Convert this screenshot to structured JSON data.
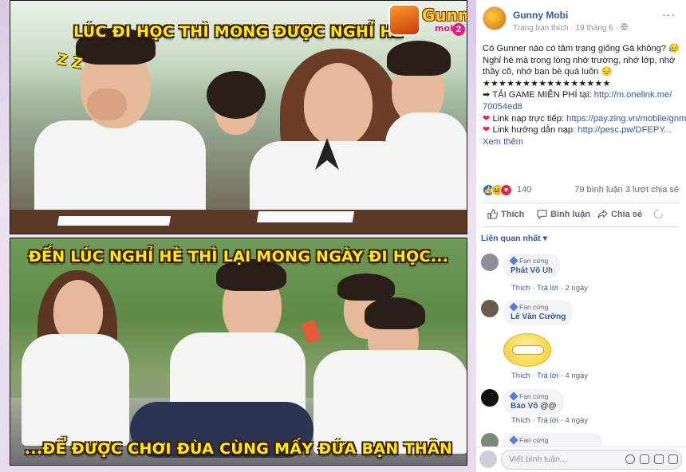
{
  "media": {
    "caption_top": "LÚC ĐI HỌC THÌ MONG ĐƯỢC NGHỈ HÈ",
    "caption_mid": "ĐẾN LÚC NGHỈ HÈ THÌ LẠI MONG NGÀY ĐI HỌC...",
    "caption_bottom": "...ĐỂ ĐƯỢC CHƠI ĐÙA CÙNG MẤY ĐỨA BẠN THÂN",
    "sleep_mark": "Z Z",
    "logo": {
      "word": "Gunny",
      "sub": "mobi",
      "num": "2"
    }
  },
  "post": {
    "page_name": "Gunny Mobi",
    "meta": "Trang bạn thích · 19 tháng 6 · ",
    "more_label": "···",
    "lines": [
      "Có Gunner nào có tâm trạng giống Gà không? 😥",
      "Nghỉ hè mà trong lòng nhớ trường, nhớ lớp, nhớ",
      "thầy cô, nhớ bạn bè quá luôn 😔",
      "★★★★★★★★★★★★★★★★"
    ],
    "download_prefix": "➡ TẢI GAME MIỄN PHÍ tại: ",
    "download_link_1": "http://m.onelink.me/",
    "download_link_2": "70054ed8",
    "topup_prefix": "Link nạp trực tiếp: ",
    "topup_link": "https://pay.zing.vn/mobile/gnm",
    "guide_prefix": "Link hướng dẫn nạp: ",
    "guide_link": "http://pesc.pw/DFEPY...",
    "see_more": "Xem thêm"
  },
  "stats": {
    "reaction_count": "140",
    "comments_shares": "79 bình luận  3 lượt chia sẻ"
  },
  "actions": {
    "like": "Thích",
    "comment": "Bình luận",
    "share": "Chia sẻ"
  },
  "sort_label": "Liên quan nhất ▾",
  "comments": [
    {
      "badge": "Fan cứng",
      "name": "Phát Võ",
      "text": "Uh",
      "like": "Thích",
      "reply": "Trả lời",
      "time": "2 ngày"
    },
    {
      "badge": "Fan cứng",
      "name": "Lê Văn Cường",
      "text": "",
      "like": "Thích",
      "reply": "Trả lời",
      "time": "4 ngày"
    },
    {
      "badge": "Fan cứng",
      "name": "Bảo Võ",
      "text": "@@",
      "like": "Thích",
      "reply": "Trả lời",
      "time": "4 ngày"
    },
    {
      "badge": "Fan cứng"
    }
  ],
  "composer": {
    "placeholder": "Viết bình luận..."
  },
  "colors": {
    "link": "#385898",
    "caption": "#ffe81a",
    "heart": "#e2264d",
    "like_blue": "#1877f2"
  }
}
